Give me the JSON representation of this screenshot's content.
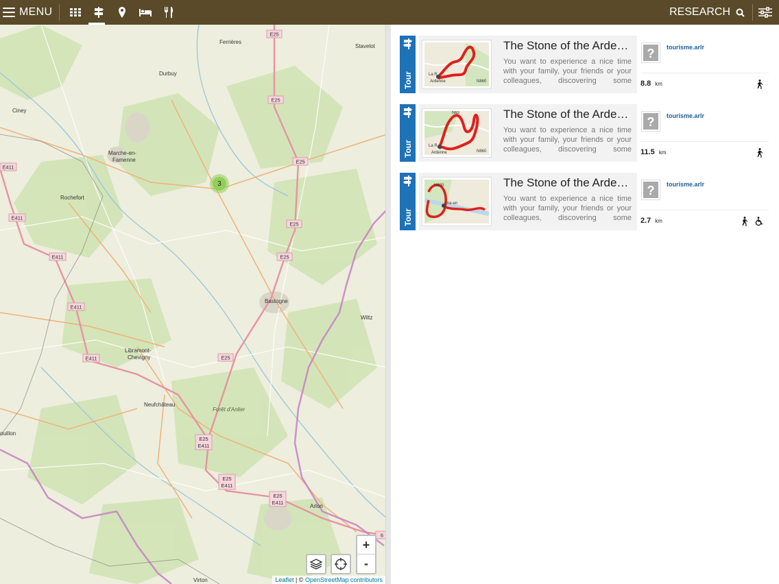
{
  "topbar": {
    "menu_label": "MENU",
    "research_label": "RESEARCH",
    "nav_icons": [
      "grid-icon",
      "signpost-icon",
      "map-pin-icon",
      "bed-icon",
      "fork-knife-icon"
    ],
    "active_icon": "signpost-icon",
    "background": "#5a4a2a"
  },
  "map": {
    "cluster_count": "3",
    "zoom_in": "+",
    "zoom_out": "-",
    "attribution_leaflet": "Leaflet",
    "attribution_sep": " | © ",
    "attribution_osm": "OpenStreetMap contributors",
    "places": {
      "ferrieres": "Ferrières",
      "stavelot": "Stavelot",
      "durbuy": "Durbuy",
      "ciney": "Ciney",
      "marche": "Marche-en-\nFamenne",
      "rochefort": "Rochefort",
      "bastogne": "Bastogne",
      "wiltz": "Wiltz",
      "libramont": "Libramont-\nChevigny",
      "neufchateau": "Neufchâteau",
      "foret": "Forêt d'Anlier",
      "arlon": "Arlon",
      "virton": "Virton",
      "bouillon": "ouillon"
    },
    "road_labels": [
      "E25",
      "E411",
      "E25\nE411"
    ],
    "edge_label": "6"
  },
  "results": [
    {
      "tab_label": "Tour",
      "title": "The Stone of the Ardennes",
      "description": "You want to experience a nice time with your family, your friends or your colleagues, discovering some beautiful",
      "source": "tourisme.arlr",
      "distance": "8.8",
      "unit": "km",
      "activities": [
        "walking-icon"
      ]
    },
    {
      "tab_label": "Tour",
      "title": "The Stone of the Ardennes",
      "description": "You want to experience a nice time with your family, your friends or your colleagues, discovering some beautiful",
      "source": "tourisme.arlr",
      "distance": "11.5",
      "unit": "km",
      "activities": [
        "walking-icon"
      ]
    },
    {
      "tab_label": "Tour",
      "title": "The Stone of the Ardennes",
      "description": "You want to experience a nice time with your family, your friends or your colleagues, discovering some beautiful",
      "source": "tourisme.arlr",
      "distance": "2.7",
      "unit": "km",
      "activities": [
        "walking-icon",
        "wheelchair-icon"
      ]
    }
  ],
  "colors": {
    "accent": "#1d72b8",
    "route": "#e0201a",
    "cluster": "#8fcf5a"
  }
}
